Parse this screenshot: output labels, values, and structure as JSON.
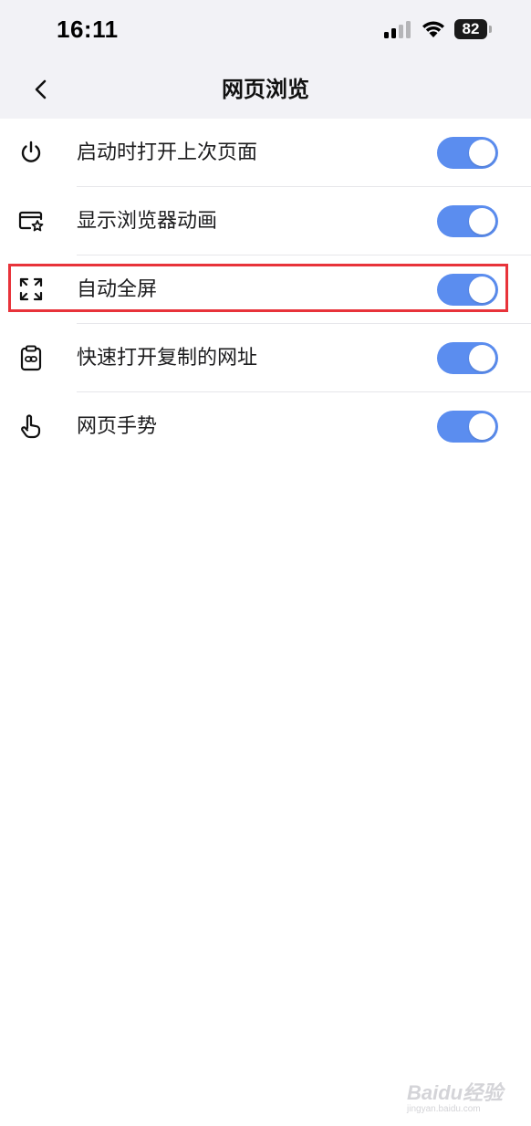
{
  "status_bar": {
    "time": "16:11",
    "battery": "82"
  },
  "nav": {
    "title": "网页浏览",
    "back_icon": "chevron-left-icon"
  },
  "settings": [
    {
      "label": "启动时打开上次页面",
      "icon": "power-icon",
      "enabled": true
    },
    {
      "label": "显示浏览器动画",
      "icon": "browser-star-icon",
      "enabled": true
    },
    {
      "label": "自动全屏",
      "icon": "fullscreen-icon",
      "enabled": true,
      "highlighted": true
    },
    {
      "label": "快速打开复制的网址",
      "icon": "clipboard-link-icon",
      "enabled": true
    },
    {
      "label": "网页手势",
      "icon": "hand-gesture-icon",
      "enabled": true
    }
  ],
  "colors": {
    "toggle_on": "#5b8def",
    "highlight_border": "#e8333a",
    "header_bg": "#f2f2f6"
  },
  "watermark": {
    "brand": "Baidu经验",
    "url": "jingyan.baidu.com"
  }
}
